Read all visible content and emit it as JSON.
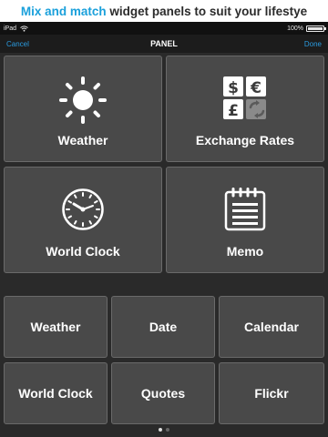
{
  "banner": {
    "highlight": "Mix and match",
    "rest": " widget panels to suit your lifestye"
  },
  "status": {
    "device": "iPad",
    "battery": "100%"
  },
  "nav": {
    "cancel": "Cancel",
    "title": "PANEL",
    "done": "Done"
  },
  "big_panels": [
    {
      "label": "Weather",
      "icon": "sun-icon"
    },
    {
      "label": "Exchange Rates",
      "icon": "currency-icon"
    },
    {
      "label": "World Clock",
      "icon": "clock-icon"
    },
    {
      "label": "Memo",
      "icon": "notepad-icon"
    }
  ],
  "small_panels": [
    "Weather",
    "Date",
    "Calendar",
    "World Clock",
    "Quotes",
    "Flickr"
  ],
  "currency_symbols": [
    "$",
    "€",
    "£"
  ],
  "pager": {
    "pages": 2,
    "current": 1
  },
  "colors": {
    "accent": "#2a9be0",
    "banner_highlight": "#1aa0db",
    "tile": "#494949",
    "background": "#2a2a2a"
  }
}
